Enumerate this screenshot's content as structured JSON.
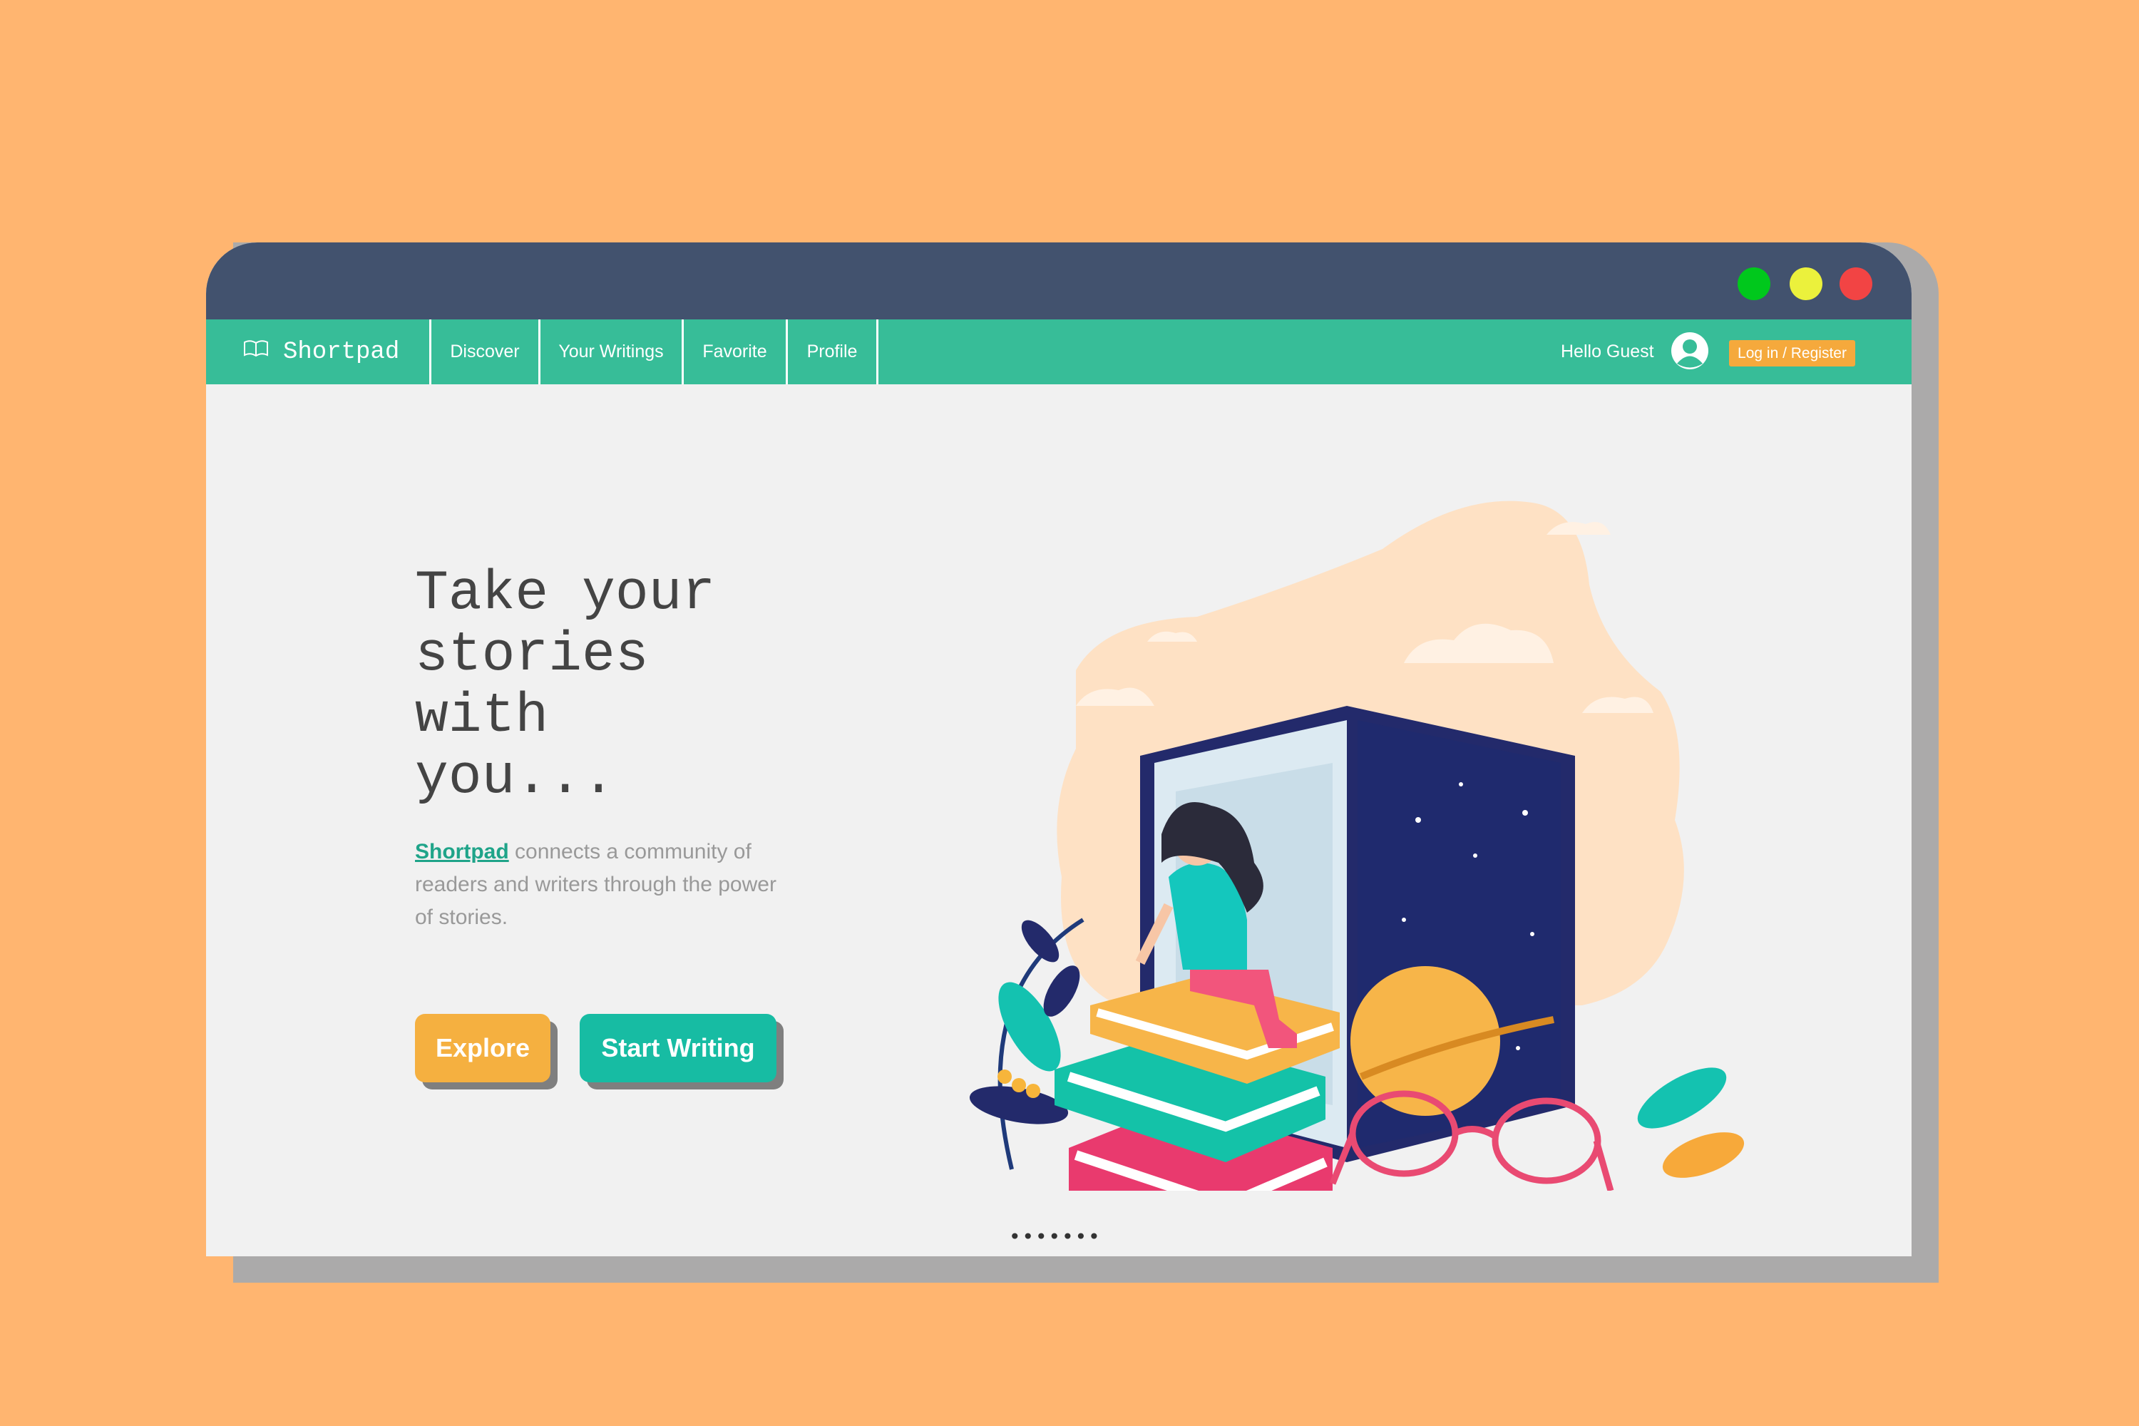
{
  "window": {
    "controls": [
      {
        "name": "maximize",
        "color": "#00C81C"
      },
      {
        "name": "minimize",
        "color": "#EBF13C"
      },
      {
        "name": "close",
        "color": "#F24444"
      }
    ]
  },
  "navbar": {
    "brand": "Shortpad",
    "brand_icon": "open-book-icon",
    "items": [
      {
        "label": "Discover"
      },
      {
        "label": "Your Writings"
      },
      {
        "label": "Favorite"
      },
      {
        "label": "Profile"
      }
    ],
    "greeting": "Hello Guest",
    "avatar_icon": "user-avatar-icon",
    "login_label": "Log in / Register"
  },
  "hero": {
    "title_lines": [
      "Take your",
      "stories",
      "with",
      "you..."
    ],
    "desc_brand": "Shortpad",
    "desc_text": " connects a community of readers and writers through the power of stories.",
    "explore_label": "Explore",
    "start_label": "Start Writing",
    "illustration_icon": "girl-reading-on-books-illustration"
  },
  "pager": {
    "dots": "•••••••"
  },
  "colors": {
    "background": "#FFB570",
    "titlebar": "#42526E",
    "navbar": "#37BD98",
    "accent_orange": "#F5A93C",
    "accent_teal": "#17BCA3"
  }
}
